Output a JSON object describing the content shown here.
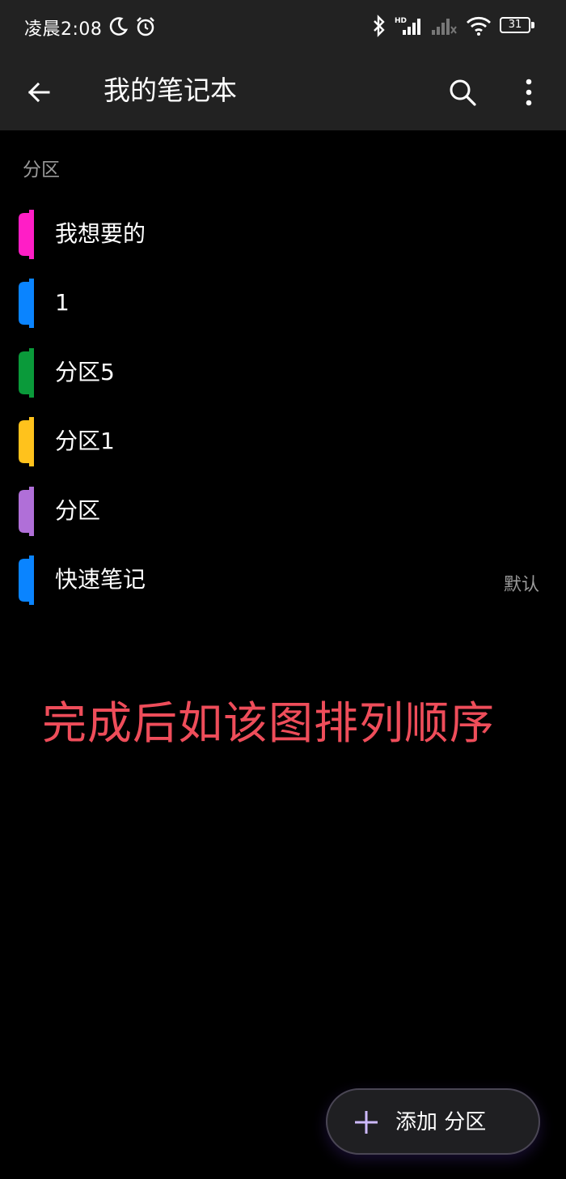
{
  "status_bar": {
    "time": "凌晨2:08",
    "battery": "31",
    "icons": [
      "moon-icon",
      "alarm-icon",
      "bluetooth-icon",
      "hd-signal-icon",
      "signal-icon",
      "wifi-icon",
      "battery-icon"
    ]
  },
  "app_bar": {
    "title": "我的笔记本",
    "icons": [
      "back-arrow-icon",
      "search-icon",
      "more-vert-icon"
    ]
  },
  "section_header": "分区",
  "sections": [
    {
      "label": "我想要的",
      "color": "#ff1ec6",
      "tag": ""
    },
    {
      "label": "1",
      "color": "#0a84ff",
      "tag": ""
    },
    {
      "label": "分区5",
      "color": "#0a9a3a",
      "tag": ""
    },
    {
      "label": "分区1",
      "color": "#ffc21c",
      "tag": ""
    },
    {
      "label": "分区",
      "color": "#b06fd8",
      "tag": ""
    },
    {
      "label": "快速笔记",
      "color": "#0a84ff",
      "tag": "默认"
    }
  ],
  "annotation": "完成后如该图排列顺序",
  "fab": {
    "label": "添加 分区",
    "icon": "plus-icon"
  }
}
